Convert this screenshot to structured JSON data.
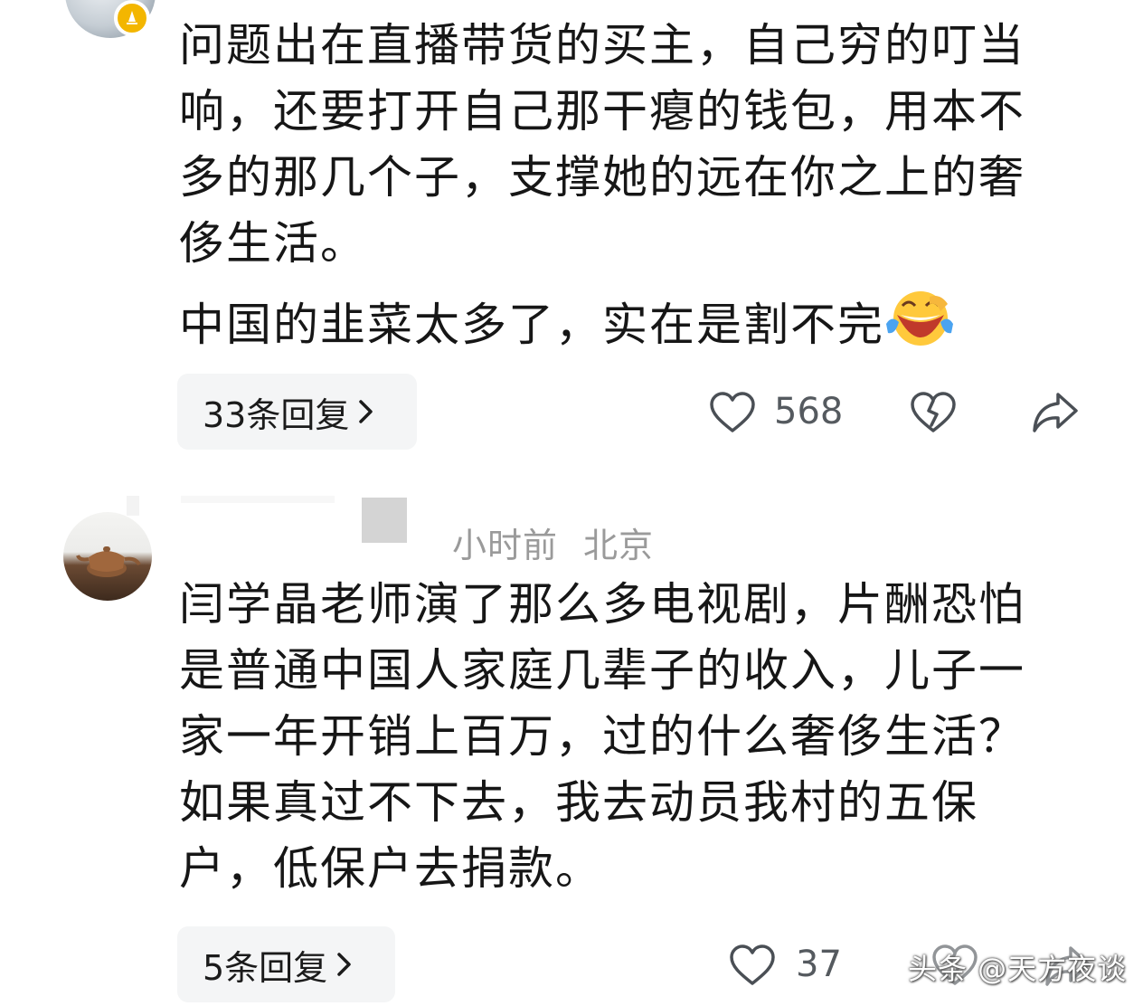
{
  "comments": [
    {
      "text_main": "问题出在直播带货的买主，自己穷的叮当响，还要打开自己那干瘪的钱包，用本不多的那几个子，支撑她的远在你之上的奢侈生活。",
      "text_second": "中国的韭菜太多了，实在是割不完",
      "emoji": "laughing-crying-emoji",
      "reply_label": "33条回复",
      "like_count": "568",
      "avatar_badge_color": "#f3b600"
    },
    {
      "meta_time": "小时前",
      "meta_location": "北京",
      "text_main": "闫学晶老师演了那么多电视剧，片酬恐怕是普通中国人家庭几辈子的收入，儿子一家一年开销上百万，过的什么奢侈生活？如果真过不下去，我去动员我村的五保户，低保户去捐款。",
      "reply_label": "5条回复",
      "like_count": "37"
    }
  ],
  "watermark": "头条 @天方夜谈",
  "icons": [
    "like-heart-icon",
    "dislike-broken-heart-icon",
    "share-arrow-icon",
    "chevron-right-icon",
    "verified-badge-icon"
  ]
}
